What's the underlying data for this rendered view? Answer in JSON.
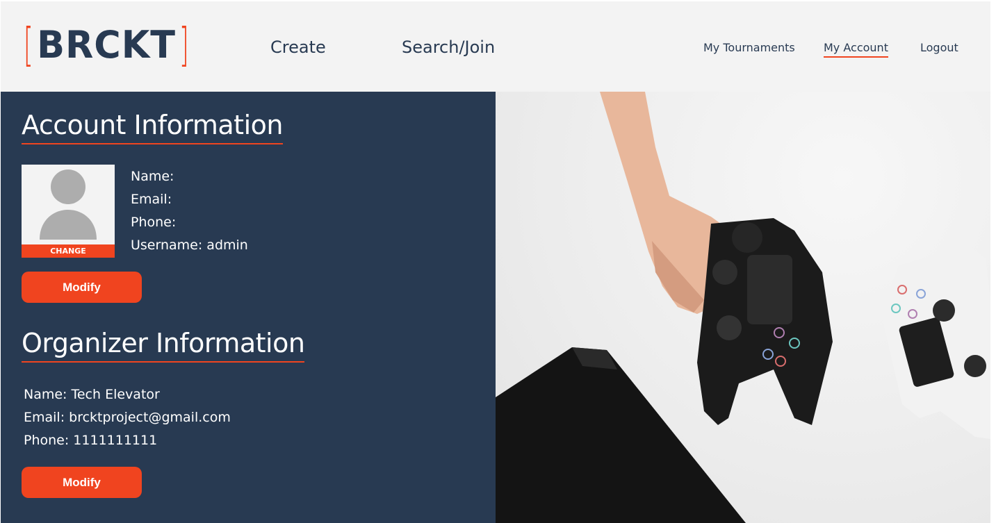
{
  "header": {
    "logo_bracket_left": "[",
    "logo_text": "BRCKT",
    "logo_bracket_right": "]",
    "nav_main": [
      "Create",
      "Search/Join"
    ],
    "nav_side": [
      "My Tournaments",
      "My Account",
      "Logout"
    ],
    "active_nav": "My Account"
  },
  "account": {
    "title": "Account Information",
    "avatar_icon": "user-silhouette-icon",
    "change_label": "CHANGE",
    "fields": [
      "Name:",
      "Email:",
      "Phone:",
      "Username: admin"
    ],
    "modify_label": "Modify"
  },
  "organizer": {
    "title": "Organizer Information",
    "fields": [
      "Name: Tech Elevator",
      "Email:  brcktproject@gmail.com",
      "Phone: 1111111111"
    ],
    "modify_label": "Modify"
  },
  "colors": {
    "accent": "#f0441f",
    "navy": "#283a52",
    "header_bg": "#f3f3f3"
  }
}
